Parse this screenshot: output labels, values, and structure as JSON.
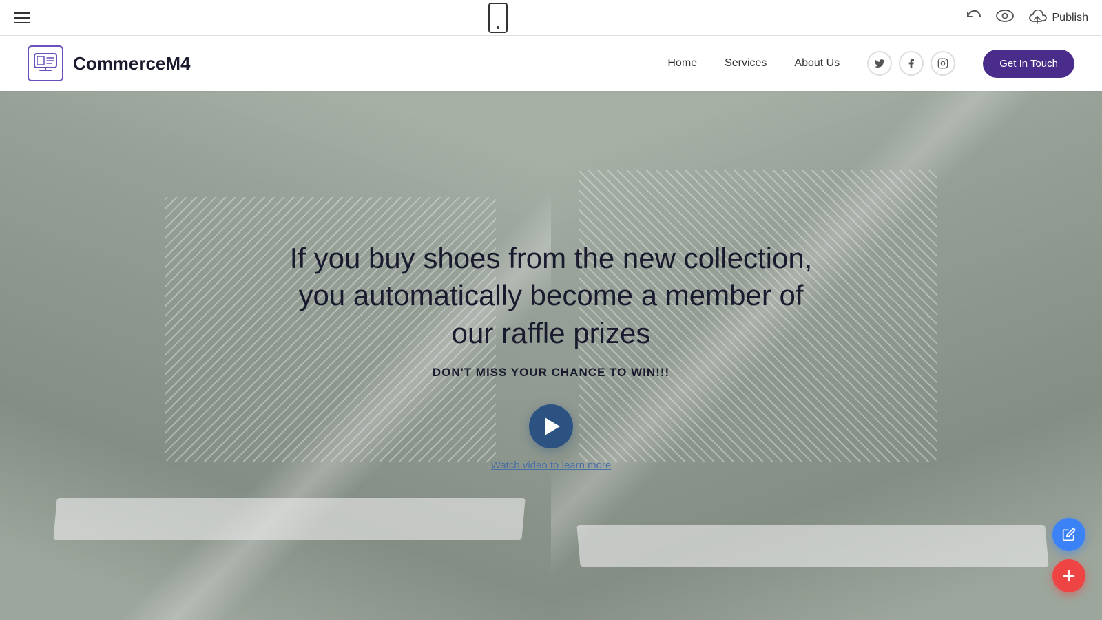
{
  "toolbar": {
    "publish_label": "Publish"
  },
  "header": {
    "logo_text": "CommerceM4",
    "nav_items": [
      {
        "label": "Home",
        "id": "home"
      },
      {
        "label": "Services",
        "id": "services"
      },
      {
        "label": "About Us",
        "id": "about"
      }
    ],
    "cta_label": "Get In Touch"
  },
  "hero": {
    "title": "If you buy shoes from the new collection, you automatically become a member of our raffle prizes",
    "subtitle": "DON'T MISS YOUR CHANCE TO WIN!!!",
    "watch_label": "Watch video to learn more"
  },
  "social": {
    "twitter": "𝕏",
    "facebook": "f",
    "instagram": "◎"
  }
}
